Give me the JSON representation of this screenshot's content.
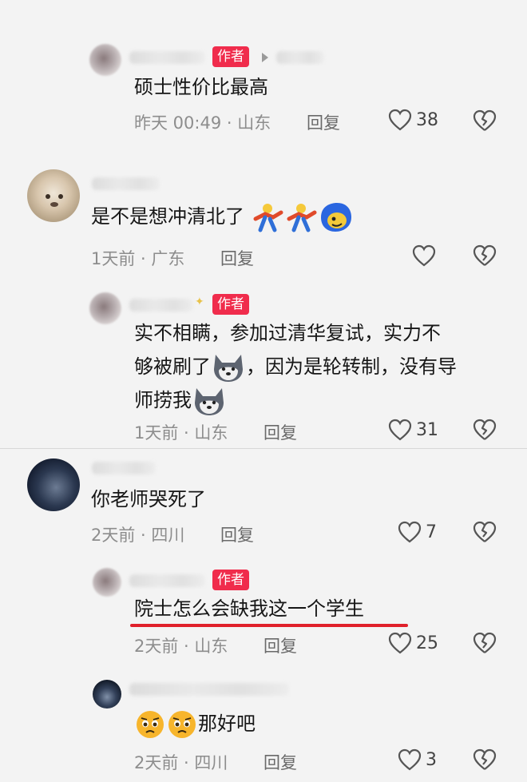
{
  "author_badge": "作者",
  "reply_label": "回复",
  "comments": [
    {
      "text": "硕士性价比最高",
      "meta": "昨天 00:49 · 山东",
      "likes": "38"
    },
    {
      "text": "是不是想冲清北了",
      "meta": "1天前 · 广东",
      "likes": ""
    },
    {
      "lines": [
        "实不相瞒，参加过清华复试，实力不",
        "够被刷了",
        "，因为是轮转制，没有导",
        "师捞我"
      ],
      "meta": "1天前 · 山东",
      "likes": "31"
    },
    {
      "text": "你老师哭死了",
      "meta": "2天前 · 四川",
      "likes": "7"
    },
    {
      "text": "院士怎么会缺我这一个学生",
      "meta": "2天前 · 山东",
      "likes": "25"
    },
    {
      "text": "那好吧",
      "meta": "2天前 · 四川",
      "likes": "3"
    }
  ],
  "icons": {
    "like": "heart-outline-icon",
    "dislike": "broken-heart-icon",
    "emoji_dance": "dancing-figure-emoji",
    "emoji_blue": "blue-face-emoji",
    "emoji_wolf": "wolf-face-emoji",
    "emoji_pleading": "pleading-face-emoji"
  },
  "colors": {
    "badge": "#f02c4c",
    "underline": "#e0202a",
    "background": "#f3f3f3"
  }
}
